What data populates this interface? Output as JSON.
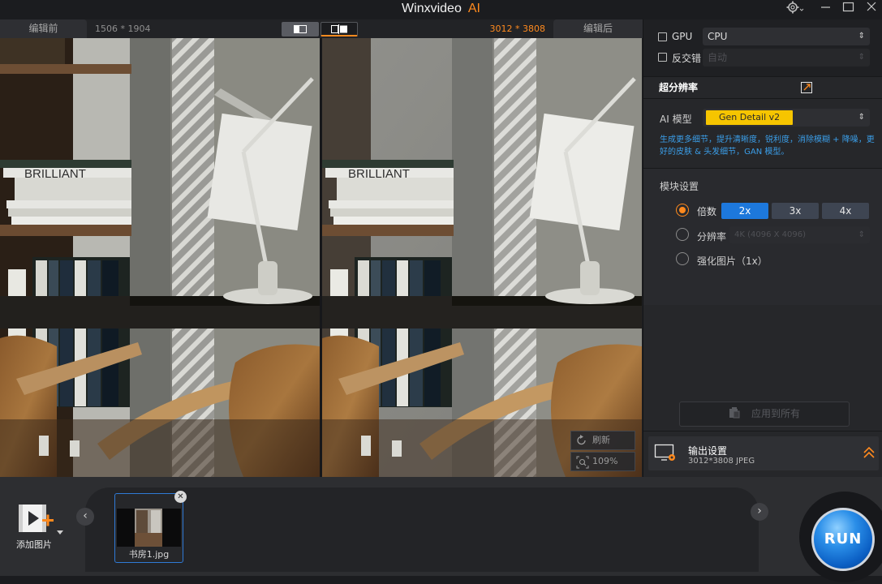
{
  "app": {
    "title": "Winxvideo",
    "title_suffix": "AI",
    "accent_color": "#ff8a1e",
    "window_controls": [
      "gear-icon",
      "minimize-icon",
      "maximize-icon",
      "close-icon"
    ]
  },
  "compare": {
    "before_label": "编辑前",
    "before_dims": "1506 * 1904",
    "after_dims": "3012 * 3808",
    "after_label": "编辑后",
    "view_modes": [
      "single-view-icon",
      "split-view-icon"
    ],
    "refresh_label": "刷新",
    "zoom": "109%"
  },
  "settings": {
    "gpu_label": "GPU",
    "device_value": "CPU",
    "deinterlace_label": "反交错",
    "deinterlace_value": "自动",
    "section_title": "超分辨率",
    "model_label": "AI 模型",
    "model_value": "Gen Detail v2",
    "model_hint": "生成更多细节，提升清晰度，锐利度，消除模糊 + 降噪，更好的皮肤 & 头发细节，GAN 模型。",
    "mode_title": "模块设置",
    "scale_label": "倍数",
    "scale_options": [
      "2x",
      "3x",
      "4x"
    ],
    "scale_selected": "2x",
    "resolution_label": "分辨率",
    "resolution_value": "4K (4096 X 4096)",
    "enhance_label": "强化图片（1x）",
    "apply_all_label": "应用到所有",
    "output_title": "输出设置",
    "output_sub": "3012*3808  JPEG"
  },
  "bottom": {
    "add_label": "添加图片",
    "file_name": "书房1.jpg",
    "run_label": "RUN"
  }
}
